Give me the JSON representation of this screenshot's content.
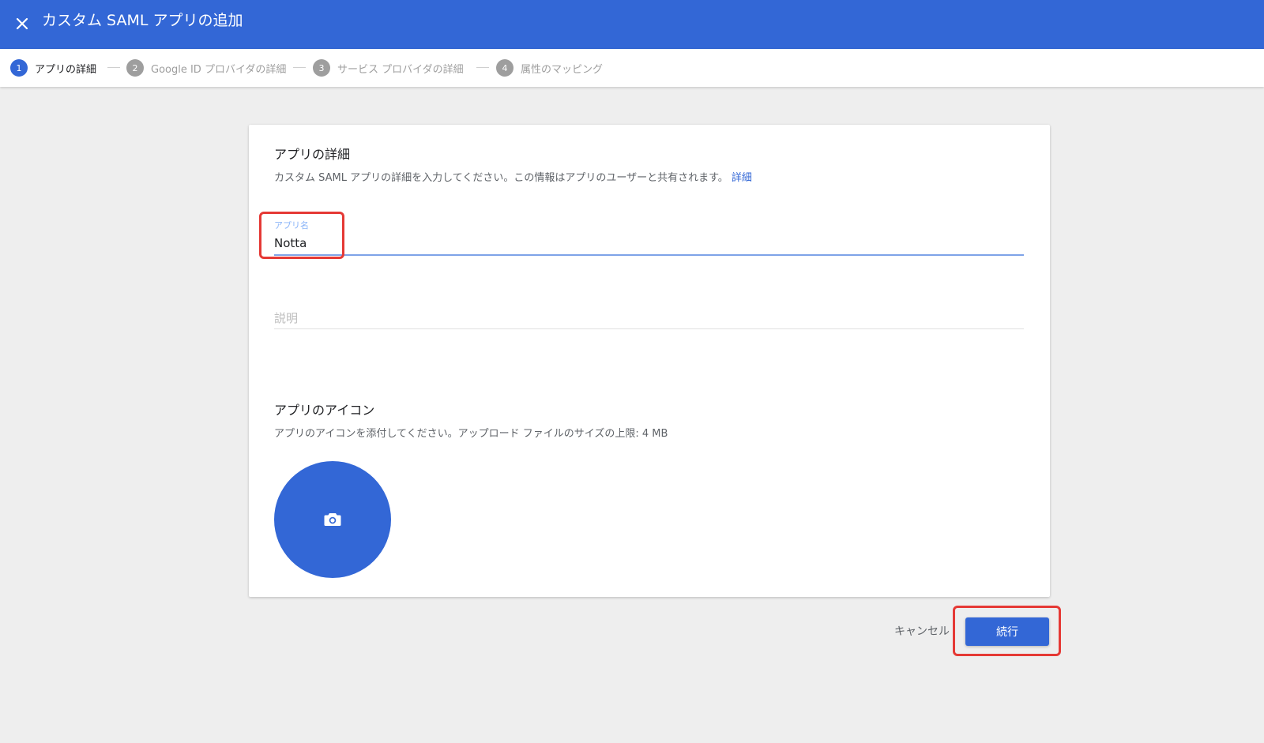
{
  "header": {
    "title": "カスタム SAML アプリの追加",
    "close_icon": "close-icon",
    "background_color": "#3367d6"
  },
  "stepper": {
    "steps": [
      {
        "number": "1",
        "label": "アプリの詳細",
        "active": true
      },
      {
        "number": "2",
        "label": "Google ID プロバイダの詳細",
        "active": false
      },
      {
        "number": "3",
        "label": "サービス プロバイダの詳細",
        "active": false
      },
      {
        "number": "4",
        "label": "属性のマッピング",
        "active": false
      }
    ]
  },
  "details": {
    "title": "アプリの詳細",
    "description": "カスタム SAML アプリの詳細を入力してください。この情報はアプリのユーザーと共有されます。",
    "link_label": "詳細",
    "app_name_label": "アプリ名",
    "app_name_value": "Notta",
    "description_placeholder": "説明"
  },
  "icon_section": {
    "title": "アプリのアイコン",
    "description": "アプリのアイコンを添付してください。アップロード ファイルのサイズの上限: 4 MB",
    "upload_icon": "camera-icon"
  },
  "actions": {
    "cancel_label": "キャンセル",
    "continue_label": "続行"
  },
  "colors": {
    "accent": "#3367d6",
    "highlight": "#e53935"
  }
}
